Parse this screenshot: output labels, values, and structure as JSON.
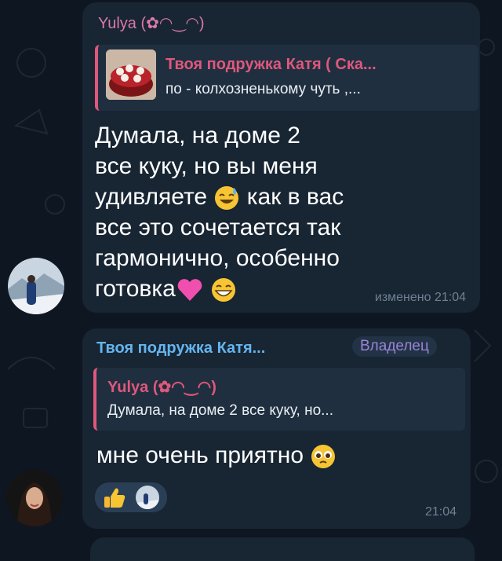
{
  "colors": {
    "background": "#0e1621",
    "bubble": "#182533",
    "reply_accent": "#e0577c",
    "link_name": "#64b5ef",
    "owner_badge": "#7a5fb0"
  },
  "message1": {
    "sender": "Yulya (✿◠‿◠)",
    "reply": {
      "author": "Твоя подружка Катя ( Ска...",
      "text": "по - колхозненькому чуть ,..."
    },
    "lines": [
      "Думала, на доме 2",
      "все куку, но вы меня",
      "удивляете",
      "как в вас",
      "все это сочетается так",
      "гармонично, особенно",
      "готовка"
    ],
    "emoji": [
      "sweat-smile-icon",
      "pink-heart-icon",
      "grin-icon"
    ],
    "meta": "изменено 21:04"
  },
  "message2": {
    "sender": "Твоя подружка Катя...",
    "badge": "Владелец",
    "reply": {
      "author": "Yulya (✿◠‿◠)",
      "text": "Думала, на доме 2 все куку, но..."
    },
    "text": "мне очень приятно",
    "emoji": "pleading-face-icon",
    "reaction": "thumbs-up-icon",
    "time": "21:04"
  }
}
